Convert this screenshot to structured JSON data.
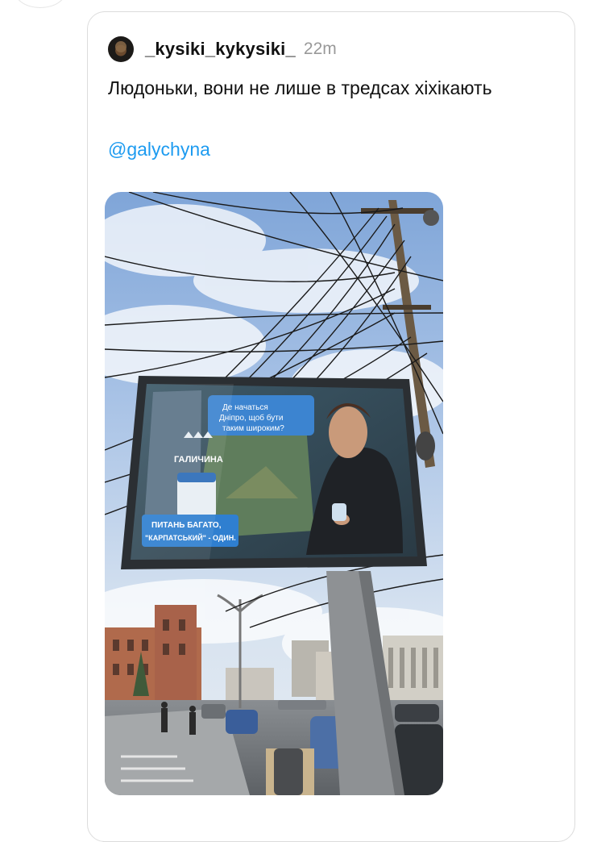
{
  "post": {
    "username": "_kysiki_kykysiki_",
    "time": "22m",
    "text": "Людоньки, вони не лише в тредсах хіхікають",
    "mention": "@galychyna"
  },
  "billboard": {
    "bubble_line1": "Де начаться",
    "bubble_line2": "Дніпро, щоб бути",
    "bubble_line3": "таким широким?",
    "brand": "ГАЛИЧИНА",
    "slogan_line1": "ПИТАНЬ БАГАТО,",
    "slogan_line2": "\"КАРПАТСЬКИЙ\" - ОДИН."
  },
  "icons": {
    "avatar": "user-avatar"
  },
  "colors": {
    "link": "#1d9bf0",
    "time": "#999999",
    "text": "#111111"
  }
}
